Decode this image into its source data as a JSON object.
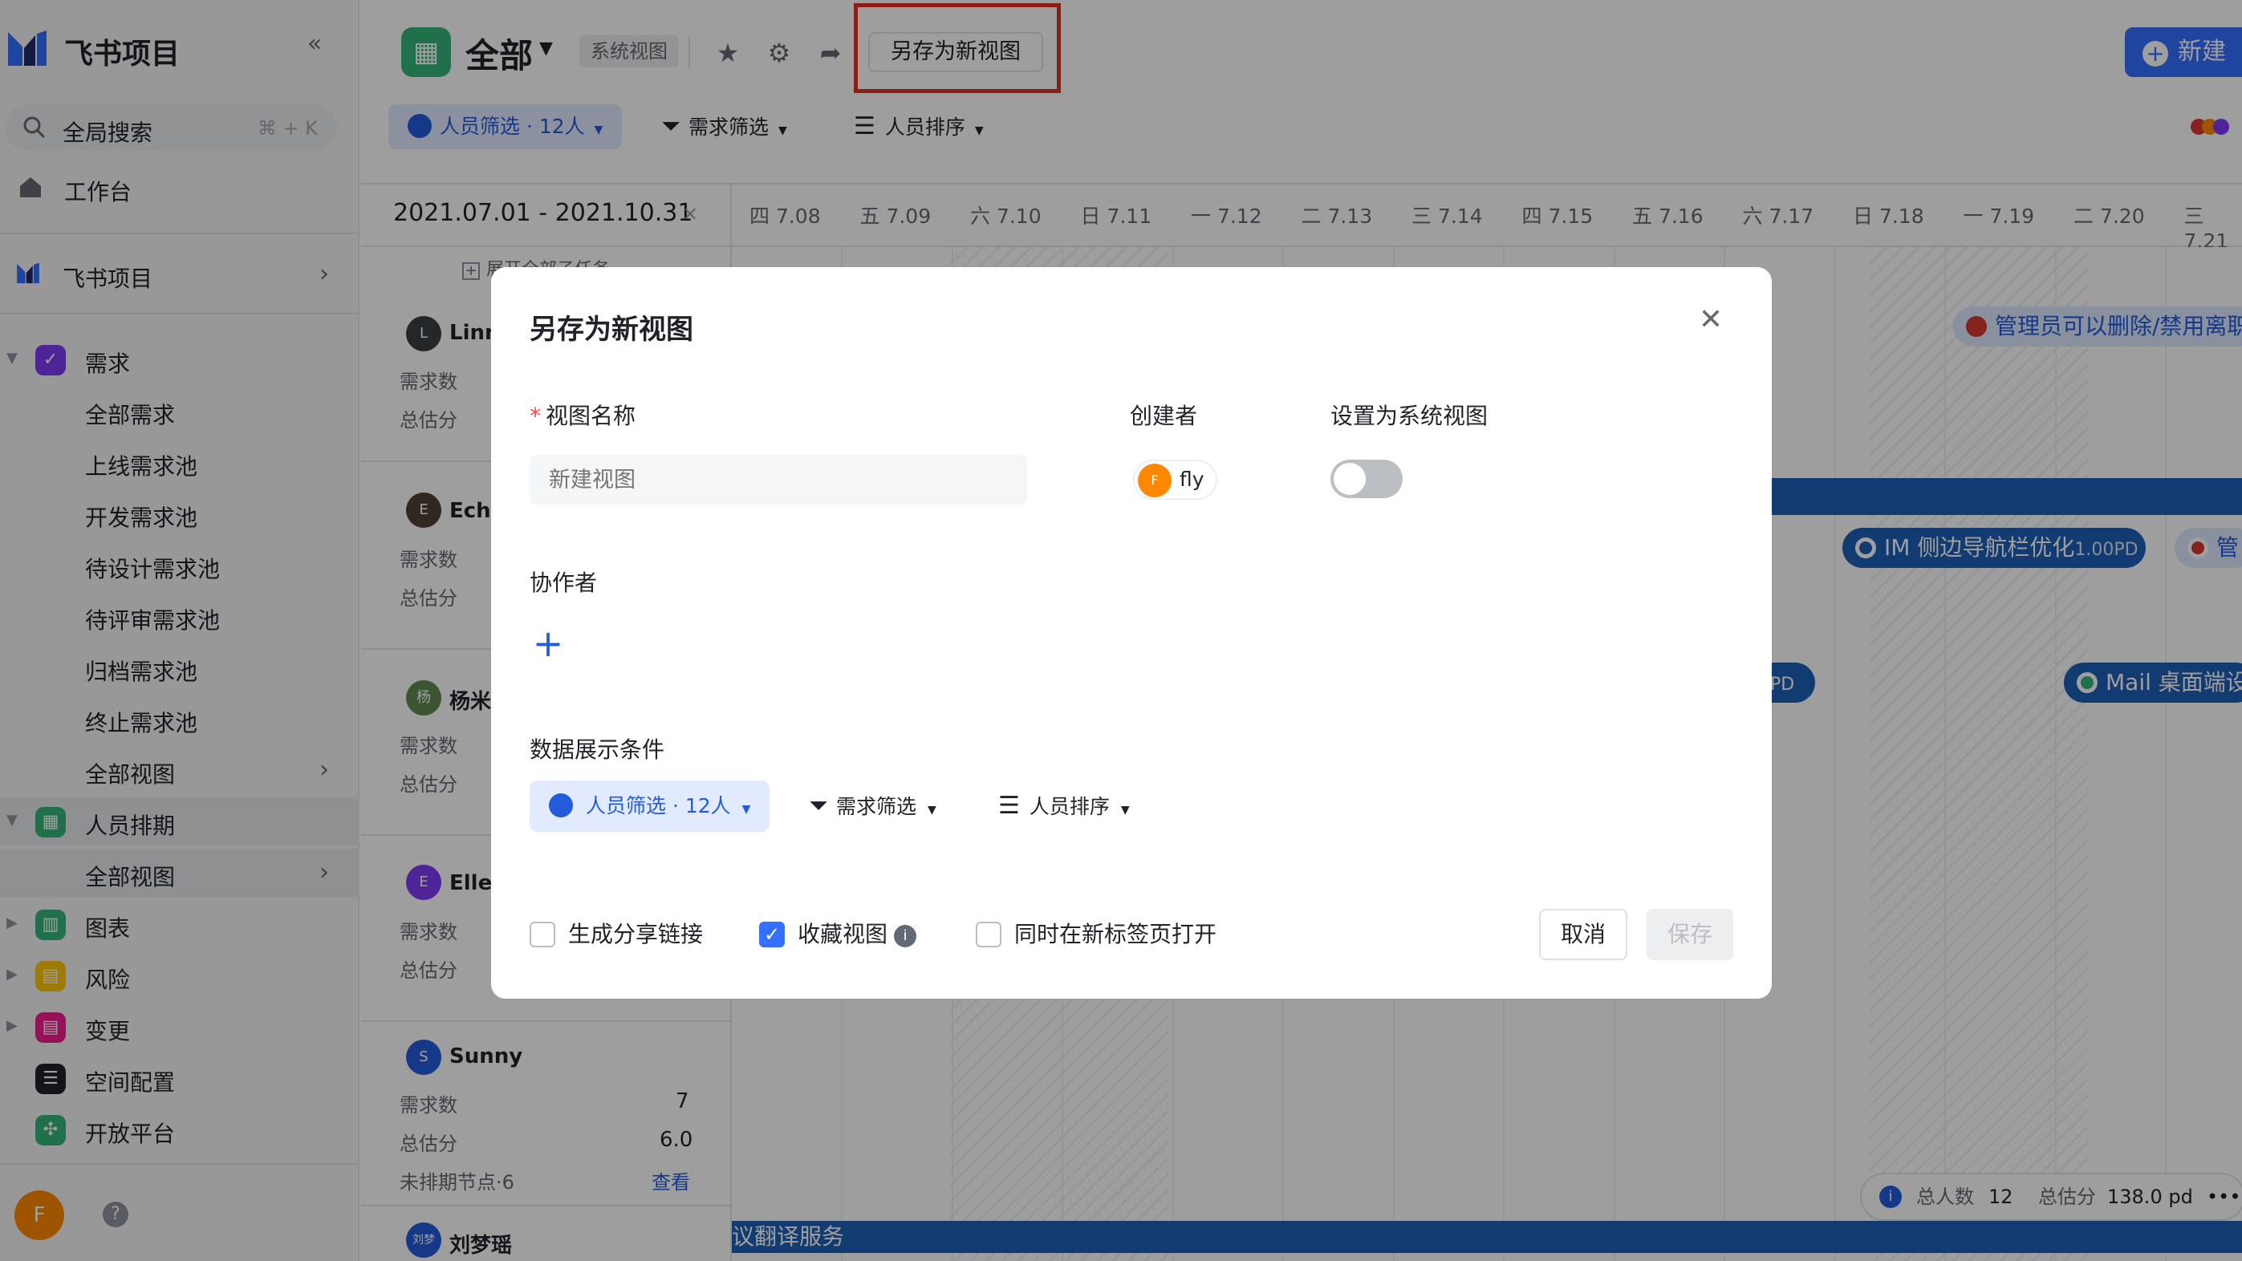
{
  "sidebar": {
    "app_name": "飞书项目",
    "search_label": "全局搜索",
    "search_shortcut": "⌘ + K",
    "workspace": "工作台",
    "project": "飞书项目",
    "requirements": {
      "label": "需求",
      "items": [
        "全部需求",
        "上线需求池",
        "开发需求池",
        "待设计需求池",
        "待评审需求池",
        "归档需求池",
        "终止需求池",
        "全部视图"
      ]
    },
    "schedule": {
      "label": "人员排期",
      "items": [
        "全部视图"
      ]
    },
    "others": [
      "图表",
      "风险",
      "变更",
      "空间配置",
      "开放平台"
    ],
    "user_initial": "F"
  },
  "header": {
    "view_title": "全部",
    "system_tag": "系统视图",
    "save_as_new": "另存为新视图",
    "new_button": "新建",
    "filters": {
      "people": "人员筛选 · 12人",
      "requirements": "需求筛选",
      "sort": "人员排序"
    }
  },
  "timeline": {
    "range": "2021.07.01 - 2021.10.31",
    "dates": [
      "四 7.08",
      "五 7.09",
      "六 7.10",
      "日 7.11",
      "一 7.12",
      "二 7.13",
      "三 7.14",
      "四 7.15",
      "五 7.16",
      "六 7.17",
      "日 7.18",
      "一 7.19",
      "二 7.20",
      "三 7.21"
    ],
    "expand_all": "展开全部子任务"
  },
  "people": [
    {
      "name": "Linm",
      "initial": "L",
      "count_label": "需求数",
      "score_label": "总估分"
    },
    {
      "name": "Echo",
      "initial": "E",
      "count_label": "需求数",
      "score_label": "总估分"
    },
    {
      "name": "杨米",
      "initial": "杨",
      "count_label": "需求数",
      "score_label": "总估分"
    },
    {
      "name": "Elle",
      "initial": "E",
      "count_label": "需求数",
      "score_label": "总估分"
    },
    {
      "name": "Sunny",
      "initial": "S",
      "count_label": "需求数",
      "score_label": "总估分",
      "count": "7",
      "score": "6.0",
      "unscheduled": "未排期节点·6",
      "view_link": "查看"
    },
    {
      "name": "刘梦瑶",
      "initial": "刘梦"
    }
  ],
  "bars": {
    "admin": "管理员可以删除/禁用离职",
    "im": "IM 侧边导航栏优化",
    "im_pd": "1.00PD",
    "pd": "PD",
    "mail": "Mail 桌面端设",
    "manage": "管",
    "translate": "议翻译服务"
  },
  "status_bar": {
    "total_people_label": "总人数",
    "total_people": "12",
    "total_score_label": "总估分",
    "total_score": "138.0 pd",
    "more": "•••"
  },
  "modal": {
    "title": "另存为新视图",
    "view_name_label": "视图名称",
    "view_name_placeholder": "新建视图",
    "creator_label": "创建者",
    "creator_name": "fly",
    "creator_initial": "F",
    "system_view_label": "设置为系统视图",
    "collaborators_label": "协作者",
    "conditions_label": "数据展示条件",
    "filters": {
      "people": "人员筛选 · 12人",
      "requirements": "需求筛选",
      "sort": "人员排序"
    },
    "share_link": "生成分享链接",
    "favorite": "收藏视图",
    "new_tab": "同时在新标签页打开",
    "cancel": "取消",
    "save": "保存"
  },
  "colors": {
    "accent": "#3370ff",
    "bar": "#1e5fb8",
    "highlight": "#e0301e"
  }
}
